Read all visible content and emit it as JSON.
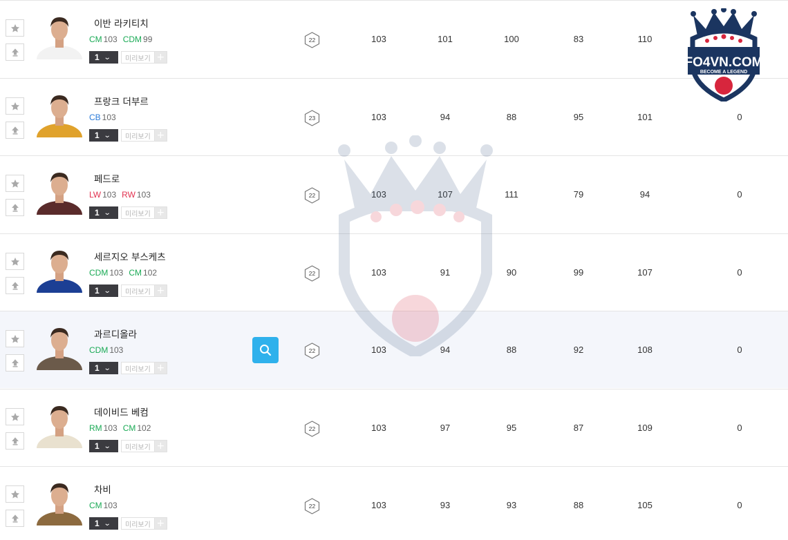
{
  "players": [
    {
      "name": "이반 라키티치",
      "positions": [
        {
          "code": "CM",
          "ovr": "103",
          "group": "mf"
        },
        {
          "code": "CDM",
          "ovr": "99",
          "group": "mf"
        }
      ],
      "level": "1",
      "preview_label": "미리보기",
      "badge": "22",
      "stats": [
        "103",
        "101",
        "100",
        "83",
        "110",
        ""
      ],
      "jersey_color": "#f2f2f2",
      "highlight": false
    },
    {
      "name": "프랑크 더부르",
      "positions": [
        {
          "code": "CB",
          "ovr": "103",
          "group": "df"
        }
      ],
      "level": "1",
      "preview_label": "미리보기",
      "badge": "23",
      "stats": [
        "103",
        "94",
        "88",
        "95",
        "101",
        "0"
      ],
      "jersey_color": "#e0a22c",
      "highlight": false
    },
    {
      "name": "페드로",
      "positions": [
        {
          "code": "LW",
          "ovr": "103",
          "group": "fw"
        },
        {
          "code": "RW",
          "ovr": "103",
          "group": "fw"
        }
      ],
      "level": "1",
      "preview_label": "미리보기",
      "badge": "22",
      "stats": [
        "103",
        "107",
        "111",
        "79",
        "94",
        "0"
      ],
      "jersey_color": "#5a2b2b",
      "highlight": false
    },
    {
      "name": "세르지오 부스케츠",
      "positions": [
        {
          "code": "CDM",
          "ovr": "103",
          "group": "mf"
        },
        {
          "code": "CM",
          "ovr": "102",
          "group": "mf"
        }
      ],
      "level": "1",
      "preview_label": "미리보기",
      "badge": "22",
      "stats": [
        "103",
        "91",
        "90",
        "99",
        "107",
        "0"
      ],
      "jersey_color": "#1c3f94",
      "highlight": false
    },
    {
      "name": "과르디올라",
      "positions": [
        {
          "code": "CDM",
          "ovr": "103",
          "group": "mf"
        }
      ],
      "level": "1",
      "preview_label": "미리보기",
      "badge": "22",
      "stats": [
        "103",
        "94",
        "88",
        "92",
        "108",
        "0"
      ],
      "jersey_color": "#6b5a4a",
      "highlight": true,
      "show_search": true
    },
    {
      "name": "데이비드 베컴",
      "positions": [
        {
          "code": "RM",
          "ovr": "103",
          "group": "mf"
        },
        {
          "code": "CM",
          "ovr": "102",
          "group": "mf"
        }
      ],
      "level": "1",
      "preview_label": "미리보기",
      "badge": "22",
      "stats": [
        "103",
        "97",
        "95",
        "87",
        "109",
        "0"
      ],
      "jersey_color": "#e9e1cf",
      "highlight": false
    },
    {
      "name": "차비",
      "positions": [
        {
          "code": "CM",
          "ovr": "103",
          "group": "mf"
        }
      ],
      "level": "1",
      "preview_label": "미리보기",
      "badge": "22",
      "stats": [
        "103",
        "93",
        "93",
        "88",
        "105",
        "0"
      ],
      "jersey_color": "#8c6a3f",
      "highlight": false
    }
  ],
  "logo": {
    "title": "FO4VN.COM",
    "tagline": "BECOME A LEGEND"
  },
  "colors": {
    "accent": "#2fb1ec",
    "midfielder": "#1aaa55",
    "defender": "#2b7bd9",
    "forward": "#e2314f",
    "logo_navy": "#1b3560",
    "logo_red": "#d7263d"
  },
  "icons": {
    "favorite": "star-icon",
    "upgrade": "arrow-up-icon",
    "dropdown": "chevron-down-icon",
    "add": "plus-icon",
    "search": "search-icon",
    "badge": "hexagon-badge-icon"
  }
}
